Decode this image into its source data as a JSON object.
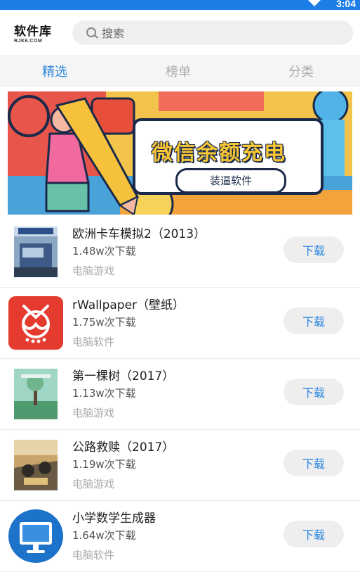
{
  "status": {
    "time": "3:04"
  },
  "header": {
    "logo_main": "软件库",
    "logo_sub": "RJK6.COM",
    "search_placeholder": "搜索"
  },
  "tabs": [
    {
      "label": "精选",
      "active": true
    },
    {
      "label": "榜单",
      "active": false
    },
    {
      "label": "分类",
      "active": false
    }
  ],
  "banner": {
    "title": "微信余额充电",
    "subtitle": "装逼软件"
  },
  "apps": [
    {
      "name": "欧洲卡车模拟2（2013）",
      "count": "1.48w次下载",
      "category": "电脑游戏",
      "button": "下载",
      "icon": "euro-truck-cover"
    },
    {
      "name": "rWallpaper（壁纸）",
      "count": "1.75w次下载",
      "category": "电脑软件",
      "button": "下载",
      "icon": "firefly-app-icon"
    },
    {
      "name": "第一棵树（2017）",
      "count": "1.13w次下载",
      "category": "电脑游戏",
      "button": "下载",
      "icon": "first-tree-cover"
    },
    {
      "name": "公路救赎（2017）",
      "count": "1.19w次下载",
      "category": "电脑游戏",
      "button": "下载",
      "icon": "road-redemption-cover"
    },
    {
      "name": "小学数学生成器",
      "count": "1.64w次下载",
      "category": "电脑软件",
      "button": "下载",
      "icon": "monitor-app-icon"
    }
  ],
  "colors": {
    "accent": "#2a86e0",
    "statusbar": "#1e7ee8",
    "app_red": "#e53b2f",
    "app_blue": "#1d73c9"
  }
}
